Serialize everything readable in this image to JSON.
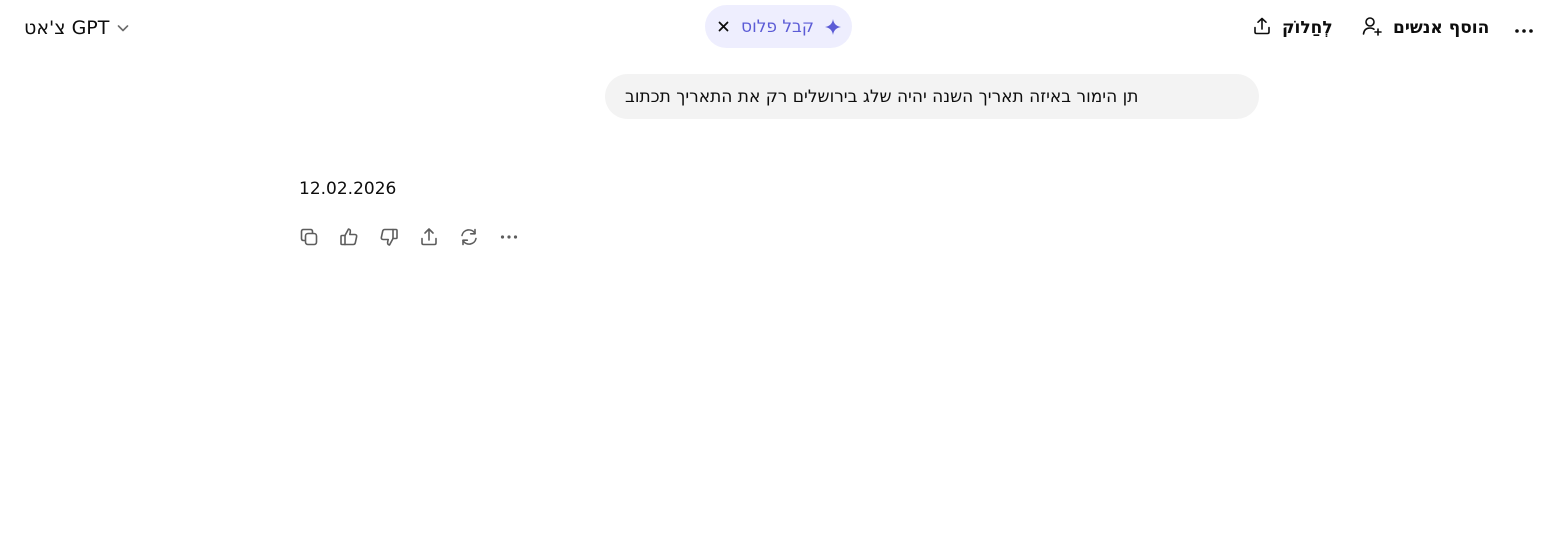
{
  "header": {
    "model_selector": {
      "label": "צ'אט GPT",
      "icon": "chevron-down-icon"
    },
    "upgrade": {
      "label": "קבל פלוס",
      "icon": "sparkle-icon",
      "close_icon": "close-icon"
    },
    "share": {
      "label": "לְחַלוֹק",
      "icon": "share-icon"
    },
    "add_people": {
      "label": "הוסף אנשים",
      "icon": "add-person-icon"
    },
    "more_icon": "more-horizontal-icon"
  },
  "conversation": {
    "user_message": "תן הימור באיזה תאריך השנה יהיה שלג בירושלים רק את התאריך תכתוב",
    "assistant_message": "12.02.2026",
    "actions": [
      {
        "name": "copy-icon"
      },
      {
        "name": "thumbs-up-icon"
      },
      {
        "name": "thumbs-down-icon"
      },
      {
        "name": "share-icon"
      },
      {
        "name": "regenerate-icon"
      },
      {
        "name": "more-horizontal-icon"
      }
    ]
  },
  "colors": {
    "background": "#ffffff",
    "text": "#0d0d0d",
    "bubble": "#f3f3f3",
    "upgrade_bg": "#eeeefe",
    "upgrade_accent": "#5b5bd6",
    "icon": "#5d5d5d"
  }
}
